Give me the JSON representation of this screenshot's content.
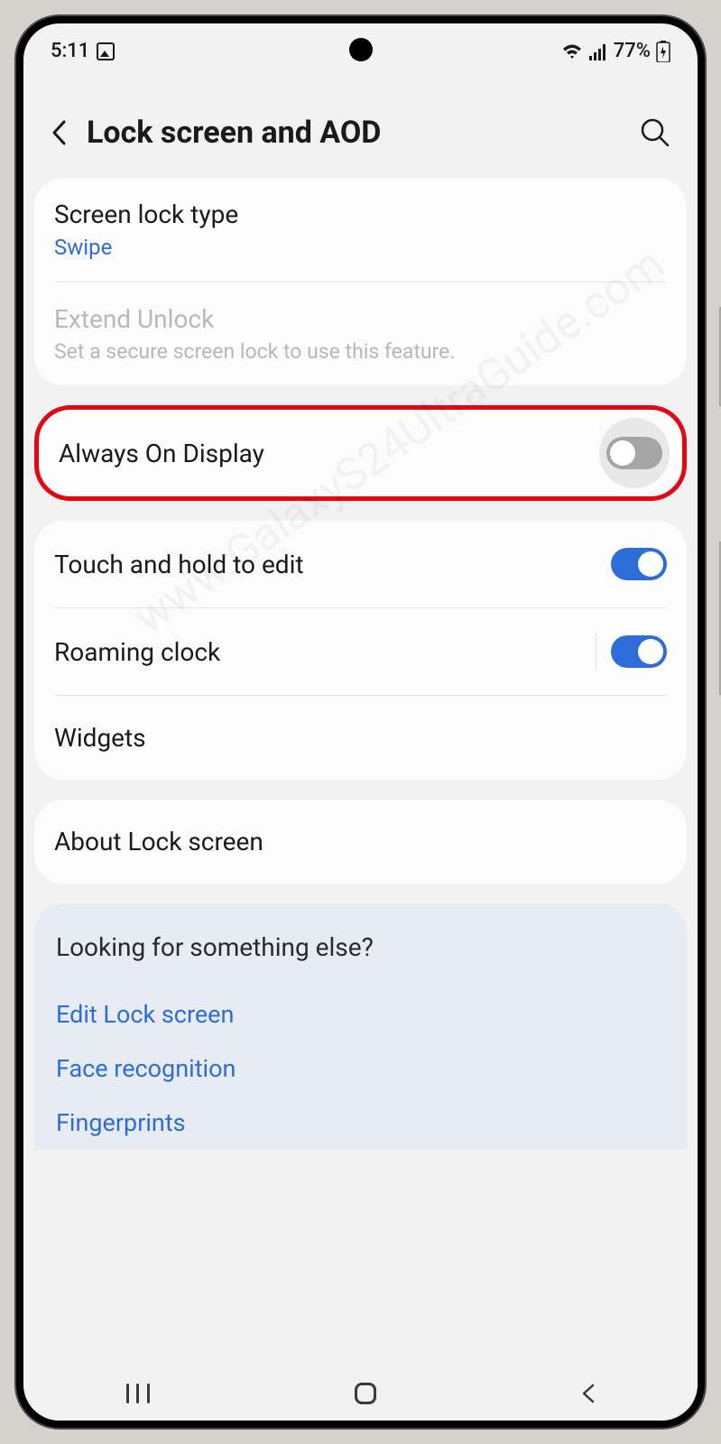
{
  "status": {
    "time": "5:11",
    "battery": "77%"
  },
  "header": {
    "title": "Lock screen and AOD"
  },
  "card1": {
    "item1": {
      "title": "Screen lock type",
      "subtitle": "Swipe"
    },
    "item2": {
      "title": "Extend Unlock",
      "subtitle": "Set a secure screen lock to use this feature."
    }
  },
  "highlighted": {
    "title": "Always On Display"
  },
  "card3": {
    "item1": {
      "title": "Touch and hold to edit"
    },
    "item2": {
      "title": "Roaming clock"
    },
    "item3": {
      "title": "Widgets"
    }
  },
  "card4": {
    "item1": {
      "title": "About Lock screen"
    }
  },
  "suggestions": {
    "title": "Looking for something else?",
    "links": {
      "0": "Edit Lock screen",
      "1": "Face recognition",
      "2": "Fingerprints"
    }
  },
  "watermark": "www.GalaxyS24UltraGuide.com"
}
